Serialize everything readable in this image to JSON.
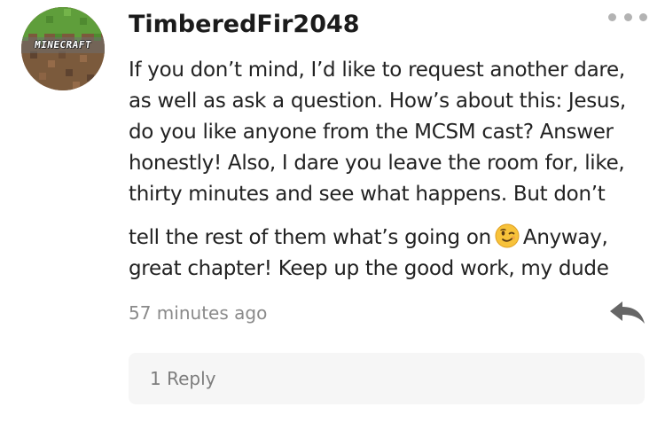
{
  "comment": {
    "avatar": {
      "text": "MINECRAFT",
      "icon": "minecraft-grass-block-avatar"
    },
    "username": "TimberedFir2048",
    "more_icon": "more-dots-icon",
    "body_lines": [
      "If you don’t mind, I’d like to request another dare,",
      "as well as ask a question. How’s about this: Jesus,",
      "do you like anyone from the MCSM cast? Answer",
      "honestly! Also, I dare you leave the room for, like,",
      "thirty minutes and see what happens. But don’t"
    ],
    "body_line6_before": "tell the rest of them what’s going on",
    "body_line6_after": "Anyway,",
    "body_line7": "great chapter! Keep up the good work, my dude",
    "emoji": "winking-face",
    "timestamp": "57 minutes ago",
    "reply_icon": "reply-arrow-icon",
    "replies_label": "1 Reply"
  },
  "colors": {
    "text": "#222222",
    "muted": "#8a8a8a",
    "replies_bg": "#f6f6f6",
    "icon_gray": "#666666"
  }
}
